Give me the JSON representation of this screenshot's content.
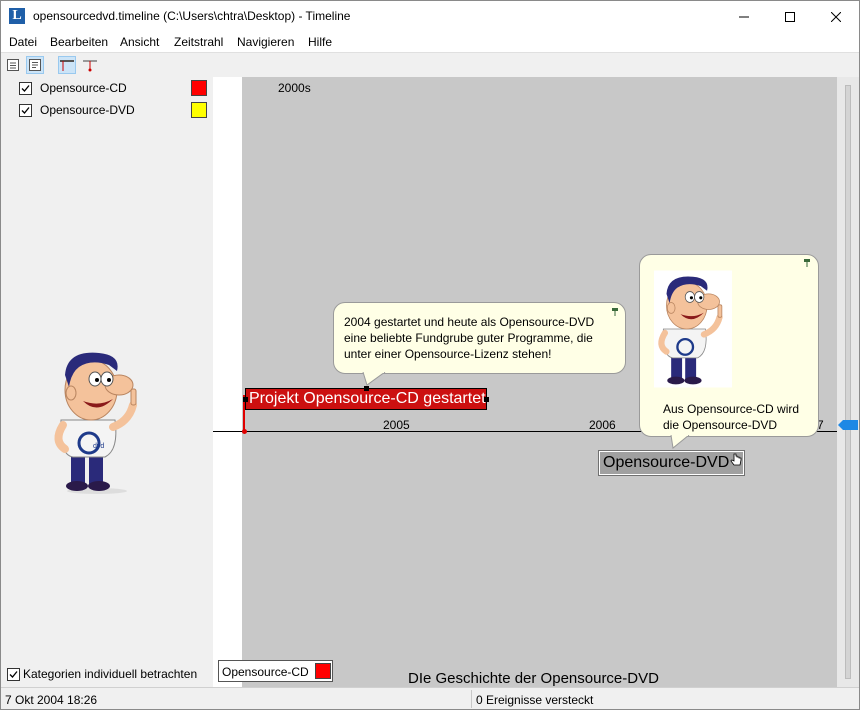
{
  "window": {
    "title": "opensourcedvd.timeline (C:\\Users\\chtra\\Desktop) - Timeline",
    "app_icon_letter": "L"
  },
  "menu": [
    "Datei",
    "Bearbeiten",
    "Ansicht",
    "Zeitstrahl",
    "Navigieren",
    "Hilfe"
  ],
  "categories": [
    {
      "label": "Opensource-CD",
      "color": "#ff0000",
      "checked": true
    },
    {
      "label": "Opensource-DVD",
      "color": "#ffff00",
      "checked": true
    }
  ],
  "category_option": {
    "label": "Kategorien individuell betrachten",
    "checked": true
  },
  "timeline": {
    "era_label": "2000s",
    "years": [
      "2005",
      "2006",
      "7"
    ],
    "events": [
      {
        "label": "Projekt Opensource-CD gestartet",
        "category": "Opensource-CD",
        "color": "#cc1010"
      },
      {
        "label": "Opensource-DVD",
        "category": "Opensource-DVD"
      }
    ],
    "bubble_cd_lines": [
      "2004 gestartet und heute als Opensource-DVD",
      "eine beliebte Fundgrube guter Programme, die",
      "unter einer Opensource-Lizenz stehen!"
    ],
    "bubble_dvd_lines": [
      "Aus Opensource-CD wird",
      "die Opensource-DVD"
    ],
    "title": "DIe Geschichte der Opensource-DVD"
  },
  "legend": {
    "label": "Opensource-CD",
    "color": "#ff0000"
  },
  "status": {
    "left": "7 Okt 2004 18:26",
    "right": "0 Ereignisse versteckt"
  }
}
